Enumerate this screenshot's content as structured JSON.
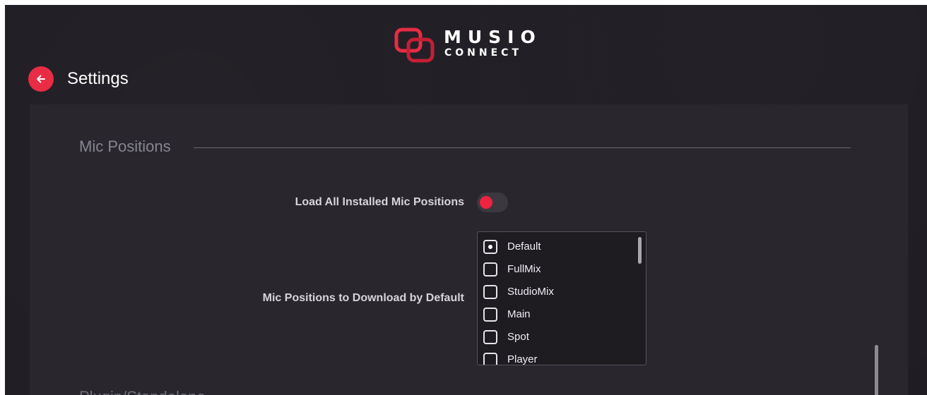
{
  "app": {
    "logo": {
      "word1": "MUSIO",
      "word2": "CONNECT"
    },
    "brand_color": "#e82c45"
  },
  "header": {
    "back_icon": "arrow-left-icon",
    "title": "Settings"
  },
  "mic_positions": {
    "section_title": "Mic Positions",
    "load_all_label": "Load All Installed Mic Positions",
    "load_all_enabled": false,
    "download_default_label": "Mic Positions to Download by Default",
    "options": [
      {
        "label": "Default",
        "selected": true
      },
      {
        "label": "FullMix",
        "selected": false
      },
      {
        "label": "StudioMix",
        "selected": false
      },
      {
        "label": "Main",
        "selected": false
      },
      {
        "label": "Spot",
        "selected": false
      },
      {
        "label": "Player",
        "selected": false
      }
    ]
  },
  "next_section": {
    "title": "Plugin/Standalone"
  }
}
